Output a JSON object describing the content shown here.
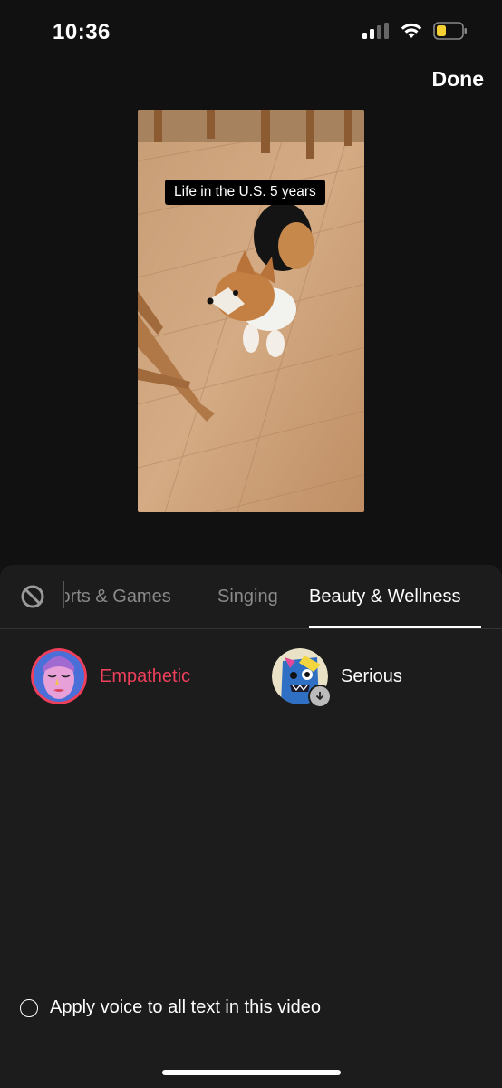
{
  "status": {
    "time": "10:36"
  },
  "header": {
    "done_label": "Done"
  },
  "video": {
    "caption": "Life in the U.S. 5 years"
  },
  "tabs": [
    {
      "label": "Sports & Games",
      "active": false
    },
    {
      "label": "Singing",
      "active": false
    },
    {
      "label": "Beauty & Wellness",
      "active": true
    }
  ],
  "voices": [
    {
      "label": "Empathetic",
      "selected": true
    },
    {
      "label": "Serious",
      "selected": false,
      "download": true
    }
  ],
  "apply_all": {
    "label": "Apply voice to all text in this video",
    "checked": false
  },
  "colors": {
    "accent": "#ee3f5b",
    "background": "#111111",
    "sheet": "#1c1c1c"
  }
}
